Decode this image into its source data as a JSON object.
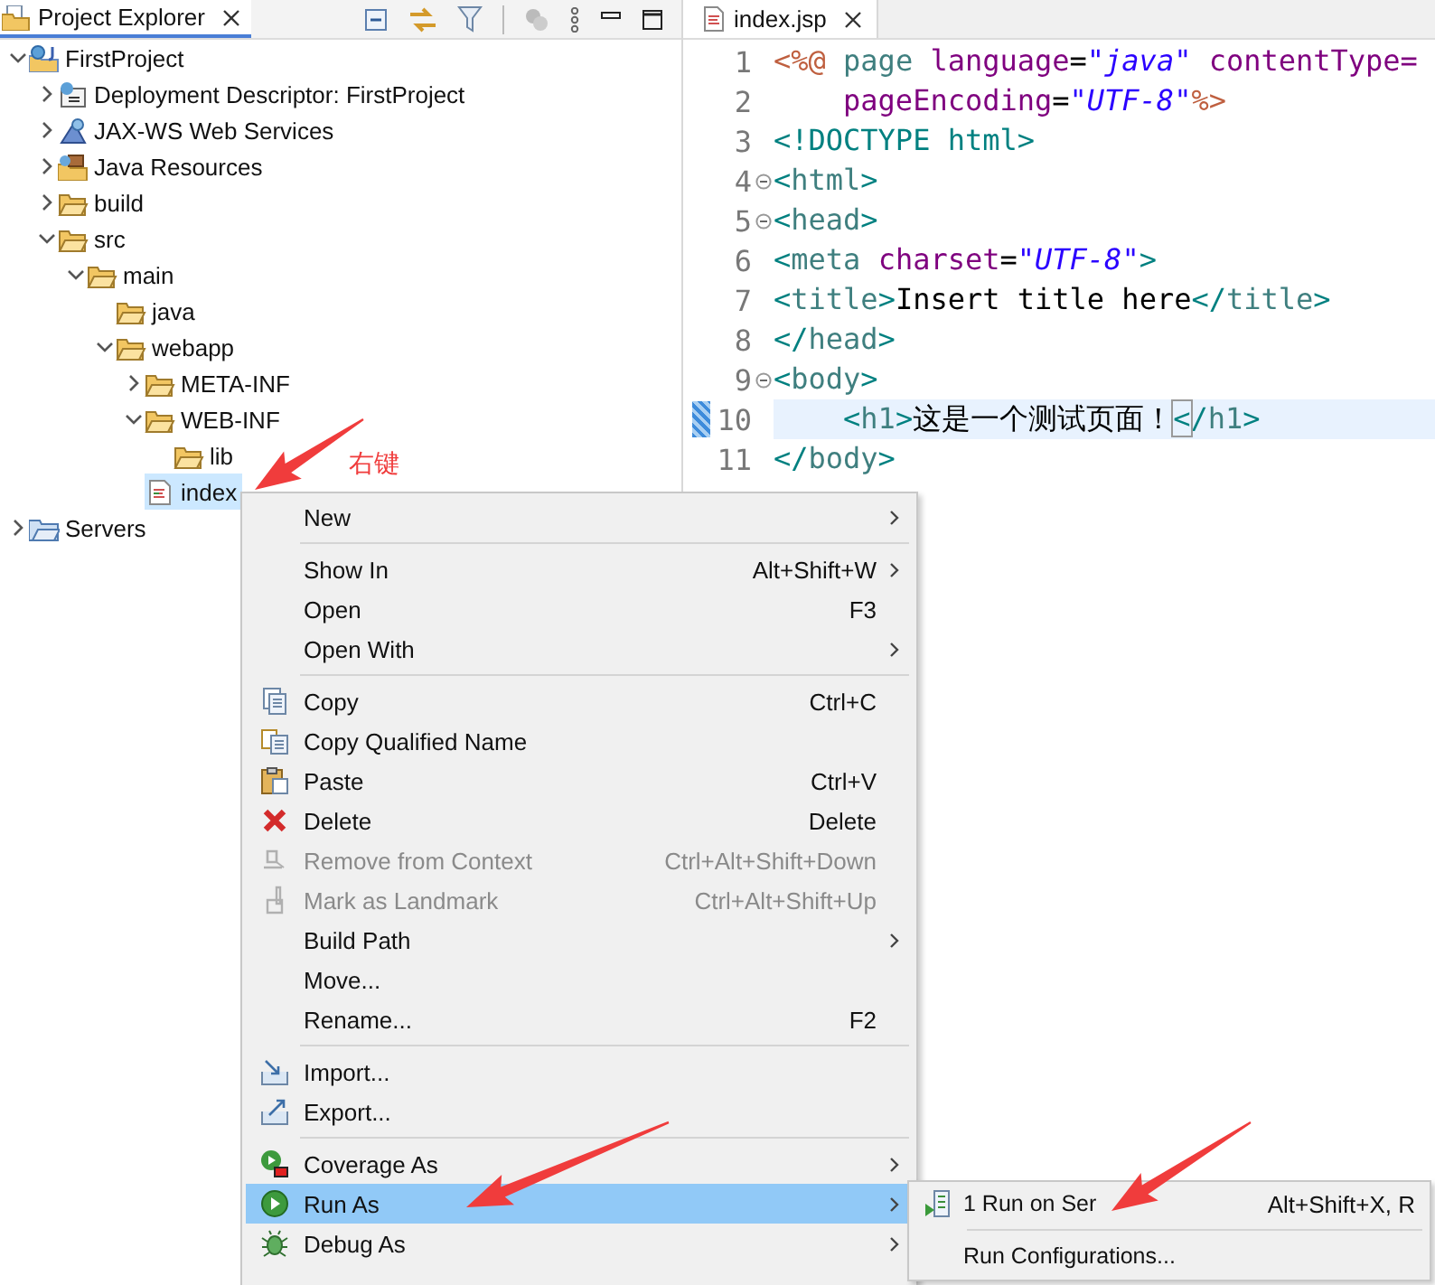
{
  "explorer": {
    "tab": {
      "label": "Project Explorer",
      "selected": true
    },
    "tree": [
      {
        "label": "FirstProject",
        "kind": "project",
        "expanded": true,
        "selected": false,
        "children": [
          {
            "label": "Deployment Descriptor: FirstProject",
            "kind": "descriptor",
            "expanded": false,
            "selected": false
          },
          {
            "label": "JAX-WS Web Services",
            "kind": "services",
            "expanded": false,
            "selected": false
          },
          {
            "label": "Java Resources",
            "kind": "resources",
            "expanded": false,
            "selected": false
          },
          {
            "label": "build",
            "kind": "folder",
            "expanded": false,
            "selected": false
          },
          {
            "label": "src",
            "kind": "folder",
            "expanded": true,
            "selected": false,
            "children": [
              {
                "label": "main",
                "kind": "folder",
                "expanded": true,
                "selected": false,
                "children": [
                  {
                    "label": "java",
                    "kind": "folder",
                    "selected": false
                  },
                  {
                    "label": "webapp",
                    "kind": "folder",
                    "expanded": true,
                    "selected": false,
                    "children": [
                      {
                        "label": "META-INF",
                        "kind": "folder",
                        "expanded": false,
                        "selected": false
                      },
                      {
                        "label": "WEB-INF",
                        "kind": "folder",
                        "expanded": true,
                        "selected": false,
                        "children": [
                          {
                            "label": "lib",
                            "kind": "folder",
                            "selected": false
                          }
                        ]
                      },
                      {
                        "label": "index",
                        "kind": "file",
                        "selected": true
                      }
                    ]
                  }
                ]
              }
            ]
          }
        ]
      },
      {
        "label": "Servers",
        "kind": "server-folder",
        "expanded": false,
        "selected": false
      }
    ]
  },
  "editor": {
    "tab": {
      "label": "index.jsp",
      "selected": true
    },
    "lines": [
      {
        "number": "1",
        "foldable": false,
        "current": false,
        "tokens": [
          {
            "text": "<%@",
            "kind": "directive"
          },
          {
            "text": " page ",
            "kind": "name"
          },
          {
            "text": "language",
            "kind": "attr"
          },
          {
            "text": "=",
            "kind": "text"
          },
          {
            "text": "\"java\"",
            "kind": "string"
          },
          {
            "text": " contentType=",
            "kind": "attr"
          }
        ]
      },
      {
        "number": "2",
        "foldable": false,
        "current": false,
        "tokens": [
          {
            "text": "    pageEncoding",
            "kind": "attr"
          },
          {
            "text": "=",
            "kind": "text"
          },
          {
            "text": "\"UTF-8\"",
            "kind": "string"
          },
          {
            "text": "%>",
            "kind": "directive"
          }
        ]
      },
      {
        "number": "3",
        "foldable": false,
        "current": false,
        "tokens": [
          {
            "text": "<!DOCTYPE html>",
            "kind": "bracket"
          }
        ]
      },
      {
        "number": "4",
        "foldable": true,
        "current": false,
        "tokens": [
          {
            "text": "<",
            "kind": "bracket"
          },
          {
            "text": "html",
            "kind": "name"
          },
          {
            "text": ">",
            "kind": "bracket"
          }
        ]
      },
      {
        "number": "5",
        "foldable": true,
        "current": false,
        "tokens": [
          {
            "text": "<",
            "kind": "bracket"
          },
          {
            "text": "head",
            "kind": "name"
          },
          {
            "text": ">",
            "kind": "bracket"
          }
        ]
      },
      {
        "number": "6",
        "foldable": false,
        "current": false,
        "tokens": [
          {
            "text": "<",
            "kind": "bracket"
          },
          {
            "text": "meta ",
            "kind": "name"
          },
          {
            "text": "charset",
            "kind": "attr"
          },
          {
            "text": "=",
            "kind": "text"
          },
          {
            "text": "\"UTF-8\"",
            "kind": "string"
          },
          {
            "text": ">",
            "kind": "bracket"
          }
        ]
      },
      {
        "number": "7",
        "foldable": false,
        "current": false,
        "tokens": [
          {
            "text": "<",
            "kind": "bracket"
          },
          {
            "text": "title",
            "kind": "name"
          },
          {
            "text": ">",
            "kind": "bracket"
          },
          {
            "text": "Insert title here",
            "kind": "text"
          },
          {
            "text": "</",
            "kind": "bracket"
          },
          {
            "text": "title",
            "kind": "name"
          },
          {
            "text": ">",
            "kind": "bracket"
          }
        ]
      },
      {
        "number": "8",
        "foldable": false,
        "current": false,
        "tokens": [
          {
            "text": "</",
            "kind": "bracket"
          },
          {
            "text": "head",
            "kind": "name"
          },
          {
            "text": ">",
            "kind": "bracket"
          }
        ]
      },
      {
        "number": "9",
        "foldable": true,
        "current": false,
        "tokens": [
          {
            "text": "<",
            "kind": "bracket"
          },
          {
            "text": "body",
            "kind": "name"
          },
          {
            "text": ">",
            "kind": "bracket"
          }
        ]
      },
      {
        "number": "10",
        "foldable": false,
        "current": true,
        "tokens": [
          {
            "text": "    <",
            "kind": "bracket"
          },
          {
            "text": "h1",
            "kind": "name"
          },
          {
            "text": ">",
            "kind": "bracket"
          },
          {
            "text": "这是一个测试页面！",
            "kind": "text"
          },
          {
            "text": "<",
            "kind": "match"
          },
          {
            "text": "/",
            "kind": "bracket"
          },
          {
            "text": "h1",
            "kind": "name"
          },
          {
            "text": ">",
            "kind": "bracket"
          }
        ]
      },
      {
        "number": "11",
        "foldable": false,
        "current": false,
        "tokens": [
          {
            "text": "</",
            "kind": "bracket"
          },
          {
            "text": "body",
            "kind": "name"
          },
          {
            "text": ">",
            "kind": "bracket"
          }
        ]
      }
    ]
  },
  "annotation": {
    "label": "右键"
  },
  "menu": {
    "groups": [
      {
        "items": [
          {
            "label": "New",
            "submenu": true,
            "disabled": false,
            "selected": false
          }
        ]
      },
      {
        "items": [
          {
            "label": "Show In",
            "shortcut": "Alt+Shift+W",
            "submenu": true,
            "disabled": false,
            "selected": false
          },
          {
            "label": "Open",
            "shortcut": "F3",
            "submenu": false,
            "disabled": false,
            "selected": false
          },
          {
            "label": "Open With",
            "submenu": true,
            "disabled": false,
            "selected": false
          }
        ]
      },
      {
        "items": [
          {
            "label": "Copy",
            "kind": "copy",
            "shortcut": "Ctrl+C",
            "submenu": false,
            "disabled": false,
            "selected": false
          },
          {
            "label": "Copy Qualified Name",
            "kind": "copy-name",
            "submenu": false,
            "disabled": false,
            "selected": false
          },
          {
            "label": "Paste",
            "kind": "paste",
            "shortcut": "Ctrl+V",
            "submenu": false,
            "disabled": false,
            "selected": false
          },
          {
            "label": "Delete",
            "kind": "delete",
            "shortcut": "Delete",
            "submenu": false,
            "disabled": false,
            "selected": false
          },
          {
            "label": "Remove from Context",
            "kind": "remove",
            "shortcut": "Ctrl+Alt+Shift+Down",
            "submenu": false,
            "disabled": true,
            "selected": false
          },
          {
            "label": "Mark as Landmark",
            "kind": "landmark",
            "shortcut": "Ctrl+Alt+Shift+Up",
            "submenu": false,
            "disabled": true,
            "selected": false
          },
          {
            "label": "Build Path",
            "submenu": true,
            "disabled": false,
            "selected": false
          },
          {
            "label": "Move...",
            "submenu": false,
            "disabled": false,
            "selected": false
          },
          {
            "label": "Rename...",
            "shortcut": "F2",
            "submenu": false,
            "disabled": false,
            "selected": false
          }
        ]
      },
      {
        "items": [
          {
            "label": "Import...",
            "kind": "import",
            "submenu": false,
            "disabled": false,
            "selected": false
          },
          {
            "label": "Export...",
            "kind": "export",
            "submenu": false,
            "disabled": false,
            "selected": false
          }
        ]
      },
      {
        "items": [
          {
            "label": "Coverage As",
            "kind": "coverage",
            "submenu": true,
            "disabled": false,
            "selected": false
          },
          {
            "label": "Run As",
            "kind": "run",
            "submenu": true,
            "disabled": false,
            "selected": true
          },
          {
            "label": "Debug As",
            "kind": "debug",
            "submenu": true,
            "disabled": false,
            "selected": false
          }
        ]
      }
    ]
  },
  "submenu": {
    "groups": [
      {
        "items": [
          {
            "label": "1 Run on Ser",
            "kind": "server",
            "shortcut": "Alt+Shift+X, R",
            "selected": false
          }
        ]
      },
      {
        "items": [
          {
            "label": "Run Configurations...",
            "selected": false
          }
        ]
      }
    ]
  }
}
